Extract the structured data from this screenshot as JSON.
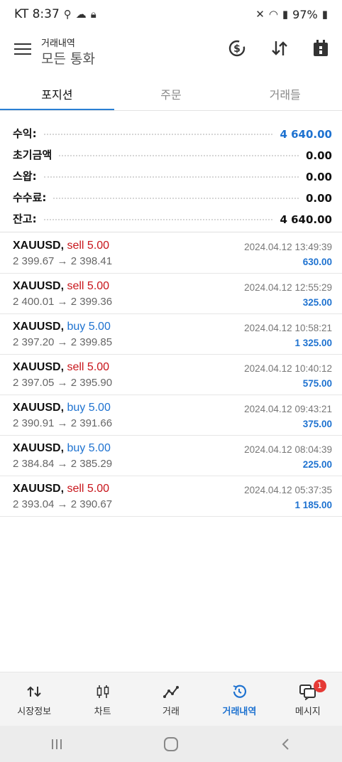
{
  "status_bar": {
    "carrier_time": "KT 8:37",
    "battery": "97%"
  },
  "app_bar": {
    "title_small": "거래내역",
    "title_big": "모든 통화"
  },
  "tabs": [
    {
      "label": "포지션",
      "active": true
    },
    {
      "label": "주문",
      "active": false
    },
    {
      "label": "거래들",
      "active": false
    }
  ],
  "summary": [
    {
      "label": "수익:",
      "value": "4 640.00",
      "highlight": true
    },
    {
      "label": "초기금액",
      "value": "0.00",
      "highlight": false
    },
    {
      "label": "스왑:",
      "value": "0.00",
      "highlight": false
    },
    {
      "label": "수수료:",
      "value": "0.00",
      "highlight": false
    },
    {
      "label": "잔고:",
      "value": "4 640.00",
      "highlight": false
    }
  ],
  "trades": [
    {
      "symbol": "XAUUSD,",
      "side": "sell 5.00",
      "type": "sell",
      "prices": "2 399.67 → 2 398.41",
      "time": "2024.04.12 13:49:39",
      "profit": "630.00"
    },
    {
      "symbol": "XAUUSD,",
      "side": "sell 5.00",
      "type": "sell",
      "prices": "2 400.01 → 2 399.36",
      "time": "2024.04.12 12:55:29",
      "profit": "325.00"
    },
    {
      "symbol": "XAUUSD,",
      "side": "buy 5.00",
      "type": "buy",
      "prices": "2 397.20 → 2 399.85",
      "time": "2024.04.12 10:58:21",
      "profit": "1 325.00"
    },
    {
      "symbol": "XAUUSD,",
      "side": "sell 5.00",
      "type": "sell",
      "prices": "2 397.05 → 2 395.90",
      "time": "2024.04.12 10:40:12",
      "profit": "575.00"
    },
    {
      "symbol": "XAUUSD,",
      "side": "buy 5.00",
      "type": "buy",
      "prices": "2 390.91 → 2 391.66",
      "time": "2024.04.12 09:43:21",
      "profit": "375.00"
    },
    {
      "symbol": "XAUUSD,",
      "side": "buy 5.00",
      "type": "buy",
      "prices": "2 384.84 → 2 385.29",
      "time": "2024.04.12 08:04:39",
      "profit": "225.00"
    },
    {
      "symbol": "XAUUSD,",
      "side": "sell 5.00",
      "type": "sell",
      "prices": "2 393.04 → 2 390.67",
      "time": "2024.04.12 05:37:35",
      "profit": "1 185.00"
    }
  ],
  "bottom_nav": [
    {
      "label": "시장정보",
      "icon": "quotes-icon",
      "active": false
    },
    {
      "label": "차트",
      "icon": "chart-candles-icon",
      "active": false
    },
    {
      "label": "거래",
      "icon": "trade-line-icon",
      "active": false
    },
    {
      "label": "거래내역",
      "icon": "history-icon",
      "active": true
    },
    {
      "label": "메시지",
      "icon": "messages-icon",
      "active": false,
      "badge": "1"
    }
  ],
  "colors": {
    "accent": "#1e72d0",
    "sell": "#c8151b",
    "badge": "#e53935"
  }
}
